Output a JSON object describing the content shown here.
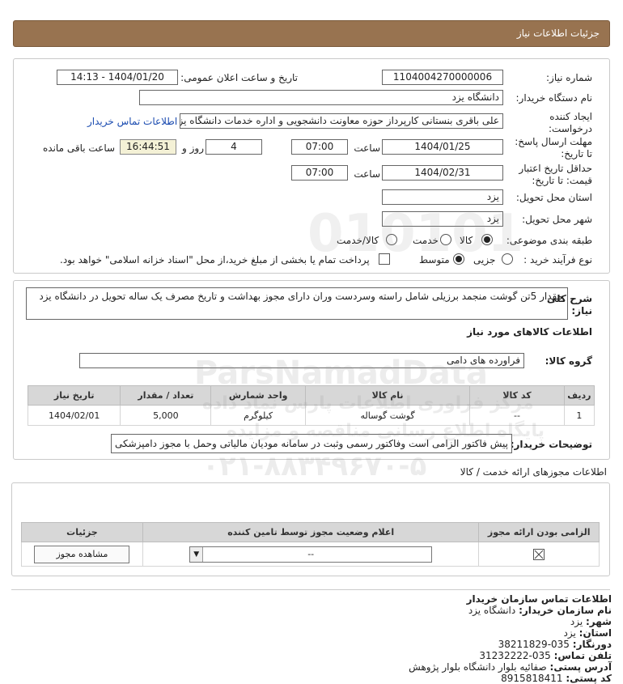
{
  "header": {
    "title": "جزئیات اطلاعات نیاز"
  },
  "form": {
    "need_number_label": "شماره نیاز:",
    "need_number": "1104004270000006",
    "announce_label": "تاریخ و ساعت اعلان عمومی:",
    "announce_value": "1404/01/20 - 14:13",
    "buyer_org_label": "نام دستگاه خریدار:",
    "buyer_org": "دانشگاه یزد",
    "creator_label_1": "ایجاد کننده",
    "creator_label_2": "درخواست:",
    "creator": "علی باقری بنستانی کارپرداز حوزه معاونت دانشجویی و اداره خدمات دانشگاه یزد",
    "contact_link": "اطلاعات تماس خریدار",
    "deadline_label_1": "مهلت ارسال پاسخ:",
    "deadline_label_2": "تا تاریخ:",
    "deadline_date": "1404/01/25",
    "time_label": "ساعت",
    "deadline_time": "07:00",
    "days_value": "4",
    "days_label": "روز و",
    "remaining_time": "16:44:51",
    "remaining_label": "ساعت باقی مانده",
    "validity_label_1": "حداقل تاریخ اعتبار",
    "validity_label_2": "قیمت: تا تاریخ:",
    "validity_date": "1404/02/31",
    "validity_time": "07:00",
    "province_label": "استان محل تحویل:",
    "province": "یزد",
    "city_label": "شهر محل تحویل:",
    "city": "یزد",
    "category_label": "طبقه بندی موضوعی:",
    "category_options": [
      "کالا",
      "خدمت",
      "کالا/خدمت"
    ],
    "category_selected": 0,
    "process_label": "نوع فرآیند خرید :",
    "process_options": [
      "جزیی",
      "متوسط"
    ],
    "process_selected": 1,
    "payment_note": "پرداخت تمام یا بخشی از مبلغ خرید،از محل \"اسناد خزانه اسلامی\" خواهد بود."
  },
  "summary": {
    "label_1": "شرح کلی",
    "label_2": "نیاز:",
    "text": "مقدار 5تن گوشت منجمد برزیلی شامل راسته وسردست وران دارای مجوز بهداشت و تاریخ مصرف یک ساله تحویل در دانشگاه یزد"
  },
  "goods": {
    "section_title": "اطلاعات کالاهای مورد نیاز",
    "group_label": "گروه کالا:",
    "group_value": "فراورده های دامی",
    "columns": [
      "ردیف",
      "کد کالا",
      "نام کالا",
      "واحد شمارش",
      "تعداد / مقدار",
      "تاریخ نیاز"
    ],
    "rows": [
      {
        "row": "1",
        "code": "--",
        "name": "گوشت گوساله",
        "unit": "کیلوگرم",
        "qty": "5,000",
        "date": "1404/02/01"
      }
    ],
    "buyer_notes_label": "توضیحات خریدار:",
    "buyer_notes": "پیش فاکتور الزامی است وفاکتور رسمی وثبت در سامانه مودیان مالیاتی وحمل با مجوز دامپزشکی"
  },
  "permits": {
    "section_title": "اطلاعات مجوزهای ارائه خدمت / کالا",
    "columns": [
      "الزامی بودن ارائه مجوز",
      "اعلام وضعیت مجوز توسط تامین کننده",
      "جزئیات"
    ],
    "select_value": "--",
    "view_button": "مشاهده مجوز"
  },
  "contact": {
    "title": "اطلاعات تماس سازمان خریدار",
    "org_label": "نام سازمان خریدار:",
    "org_value": "دانشگاه یزد",
    "city_label": "شهر:",
    "city_value": "یزد",
    "province_label": "استان:",
    "province_value": "یزد",
    "fax_label": "دورنگار:",
    "fax_value": "035-38211829",
    "phone_label": "تلفن تماس:",
    "phone_value": "035-31232222",
    "address_label": "آدرس پستی:",
    "address_value": "صفائیه بلوار دانشگاه بلوار پژوهش",
    "postal_label": "کد پستی:",
    "postal_value": "8915818411"
  },
  "watermark": {
    "line1": "ParsNamadData",
    "line2": "مرکز فراوری اطلاعات پارس نماد داده",
    "line3": "پایگاه اطلاع رسانی مناقصه و مزایده",
    "line4": "۰۲۱-۸۸۳۴۹۶۷۰-۵"
  }
}
